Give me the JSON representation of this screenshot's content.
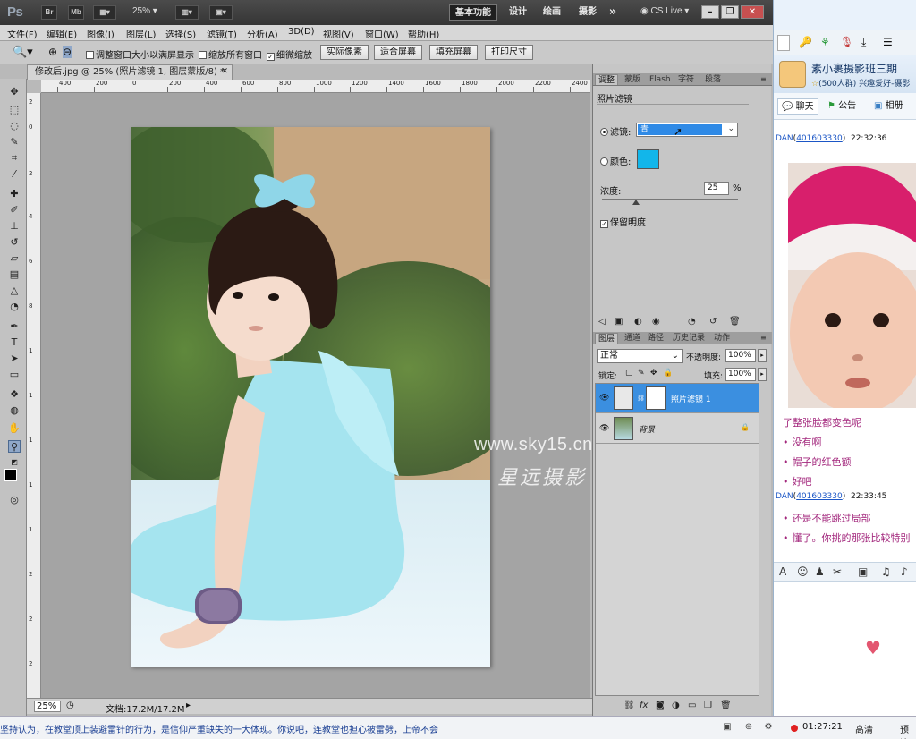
{
  "titlebar": {
    "app_logo": "Ps",
    "br_button": "Br",
    "mb_button": "Mb",
    "zoom": "25%",
    "workspaces": [
      "基本功能",
      "设计",
      "绘画",
      "摄影"
    ],
    "overflow": "»",
    "cs_live": "CS Live"
  },
  "menu": [
    "文件(F)",
    "编辑(E)",
    "图像(I)",
    "图层(L)",
    "选择(S)",
    "滤镜(T)",
    "分析(A)",
    "3D(D)",
    "视图(V)",
    "窗口(W)",
    "帮助(H)"
  ],
  "options": {
    "resize_windows": "调整窗口大小以满屏显示",
    "zoom_all": "缩放所有窗口",
    "scrubby_zoom": "细微缩放",
    "actual_pixels": "实际像素",
    "fit_screen": "适合屏幕",
    "fill_screen": "填充屏幕",
    "print_size": "打印尺寸"
  },
  "document": {
    "tab_title": "修改后.jpg @ 25% (照片滤镜 1, 图层蒙版/8) *",
    "ruler_ticks": [
      "400",
      "200",
      "0",
      "200",
      "400",
      "600",
      "800",
      "1000",
      "1200",
      "1400",
      "1600",
      "1800",
      "2000",
      "2200",
      "2400"
    ],
    "watermark_url": "www.sky15.cn",
    "watermark_cn": "星远摄影",
    "status_zoom": "25%",
    "status_doc": "文档:17.2M/17.2M"
  },
  "adjust_panel": {
    "tabs": [
      "调整",
      "蒙版",
      "Flash",
      "字符",
      "段落"
    ],
    "title": "照片滤镜",
    "filter_label": "滤镜:",
    "filter_value": "青",
    "color_label": "颜色:",
    "color_hex": "#12b6ea",
    "density_label": "浓度:",
    "density_value": "25",
    "density_unit": "%",
    "density_fraction": 0.25,
    "preserve_label": "保留明度"
  },
  "layers_panel": {
    "tabs": [
      "图层",
      "通道",
      "路径",
      "历史记录",
      "动作"
    ],
    "blend_mode": "正常",
    "opacity_label": "不透明度:",
    "opacity_value": "100%",
    "lock_label": "锁定:",
    "fill_label": "填充:",
    "fill_value": "100%",
    "layers": [
      {
        "name": "照片滤镜 1"
      },
      {
        "name": "背景"
      }
    ]
  },
  "chat": {
    "group_name": "素小裹摄影班三期",
    "group_sub": "(500人群) 兴趣爱好-摄影",
    "tabs": [
      "聊天",
      "公告",
      "相册"
    ],
    "messages_a": {
      "sender_name": "DAN",
      "sender_id": "401603330",
      "time": "22:32:36"
    },
    "lines_a": [
      "了整张脸都变色呢",
      "没有啊",
      "帽子的红色额",
      "好吧"
    ],
    "messages_b": {
      "sender_name": "DAN",
      "sender_id": "401603330",
      "time": "22:33:45"
    },
    "lines_b": [
      "还是不能跳过局部",
      "懂了。你挑的那张比较特别"
    ]
  },
  "taskbar": {
    "ticker": "坚持认为，在教堂顶上装避雷针的行为，是信仰严重缺失的一大体现。你说吧，连教堂也担心被雷劈，上帝不会",
    "rec_time": "01:27:21",
    "hd": "高清",
    "preview": "预览"
  }
}
